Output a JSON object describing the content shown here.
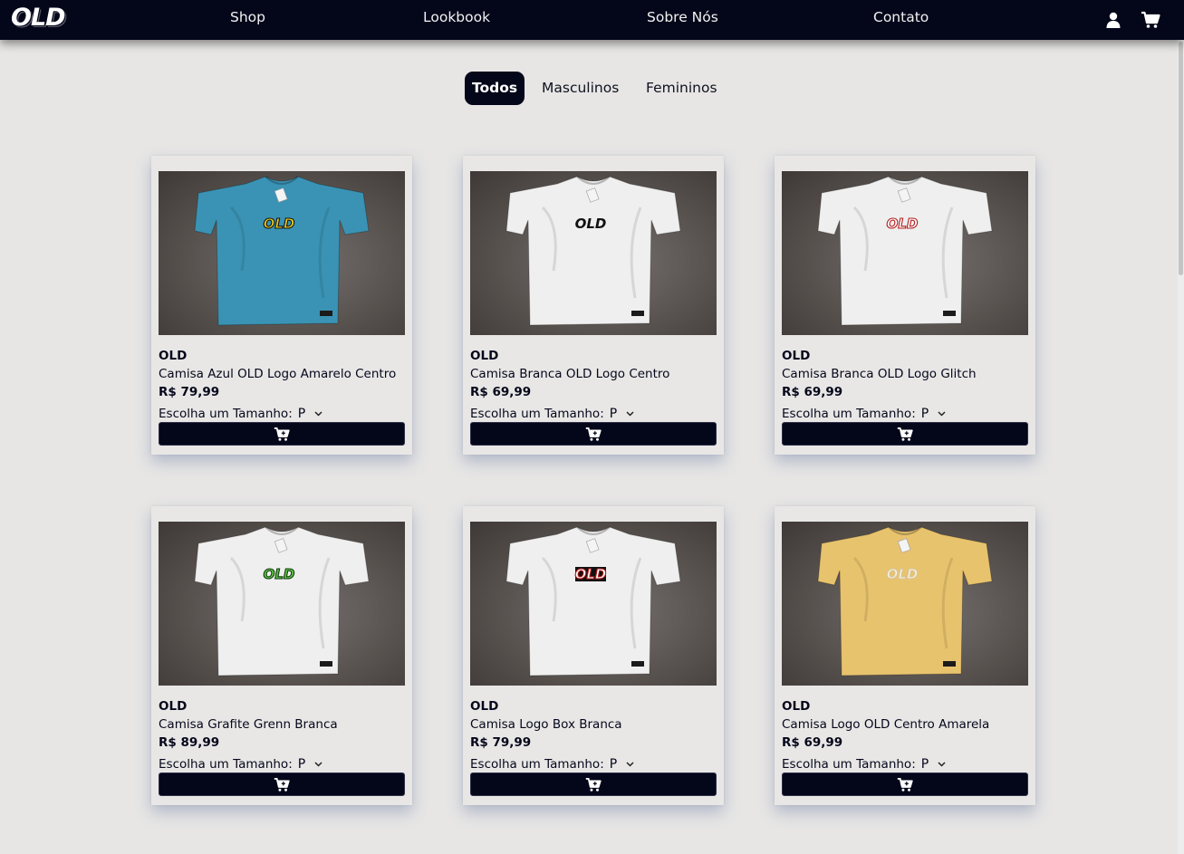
{
  "header": {
    "logo": "OLD",
    "nav": [
      {
        "label": "Shop"
      },
      {
        "label": "Lookbook"
      },
      {
        "label": "Sobre Nós"
      },
      {
        "label": "Contato"
      }
    ],
    "icons": [
      "user-icon",
      "cart-icon"
    ]
  },
  "filters": [
    {
      "label": "Todos",
      "active": true
    },
    {
      "label": "Masculinos",
      "active": false
    },
    {
      "label": "Femininos",
      "active": false
    }
  ],
  "size_label": "Escolha um Tamanho:",
  "products": [
    {
      "brand": "OLD",
      "name": "Camisa Azul OLD Logo Amarelo Centro",
      "price": "R$ 79,99",
      "size": "P",
      "shirt_color": "#3a93b4",
      "print": "OLD",
      "print_style": "yellow"
    },
    {
      "brand": "OLD",
      "name": "Camisa Branca OLD Logo Centro",
      "price": "R$ 69,99",
      "size": "P",
      "shirt_color": "#efefef",
      "print": "OLD",
      "print_style": "black"
    },
    {
      "brand": "OLD",
      "name": "Camisa Branca OLD Logo Glitch",
      "price": "R$ 69,99",
      "size": "P",
      "shirt_color": "#efefef",
      "print": "OLD",
      "print_style": "glitch"
    },
    {
      "brand": "OLD",
      "name": "Camisa Grafite Grenn Branca",
      "price": "R$ 89,99",
      "size": "P",
      "shirt_color": "#efefef",
      "print": "OLD",
      "print_style": "green"
    },
    {
      "brand": "OLD",
      "name": "Camisa Logo Box Branca",
      "price": "R$ 79,99",
      "size": "P",
      "shirt_color": "#efefef",
      "print": "OLD",
      "print_style": "box"
    },
    {
      "brand": "OLD",
      "name": "Camisa Logo OLD Centro Amarela",
      "price": "R$ 69,99",
      "size": "P",
      "shirt_color": "#e8c36e",
      "print": "OLD",
      "print_style": "tonal"
    }
  ]
}
